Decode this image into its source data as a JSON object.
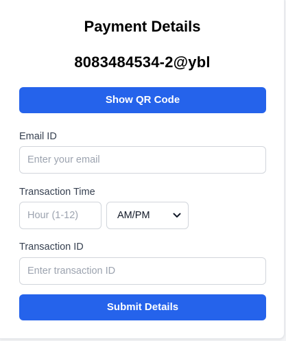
{
  "payment": {
    "title": "Payment Details",
    "upi_id": "8083484534-2@ybl",
    "show_qr_label": "Show QR Code"
  },
  "form": {
    "email": {
      "label": "Email ID",
      "placeholder": "Enter your email"
    },
    "time": {
      "label": "Transaction Time",
      "hour_placeholder": "Hour (1-12)",
      "ampm_value": "AM/PM"
    },
    "transaction": {
      "label": "Transaction ID",
      "placeholder": "Enter transaction ID"
    },
    "submit_label": "Submit Details"
  },
  "icons": {
    "select_arrow": "chevron-down-icon"
  },
  "colors": {
    "primary": "#2563eb",
    "label": "#374151",
    "placeholder": "#9ca3af",
    "border": "#d1d5db"
  }
}
